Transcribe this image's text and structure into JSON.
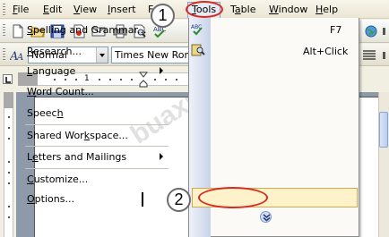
{
  "menubar": {
    "items": [
      {
        "label": "File",
        "mnemonic": "F",
        "rest": "ile"
      },
      {
        "label": "Edit",
        "mnemonic": "E",
        "rest": "dit"
      },
      {
        "label": "View",
        "mnemonic": "V",
        "rest": "iew"
      },
      {
        "label": "Insert",
        "mnemonic": "I",
        "rest": "nsert"
      },
      {
        "label": "F",
        "mnemonic": "F",
        "rest": ""
      },
      {
        "label": "Tools",
        "mnemonic": "T",
        "rest": "ools"
      },
      {
        "label": "Table",
        "mnemonic": "a",
        "pre": "T",
        "rest": "ble"
      },
      {
        "label": "Window",
        "mnemonic": "W",
        "rest": "indow"
      },
      {
        "label": "Help",
        "mnemonic": "H",
        "rest": "elp"
      }
    ]
  },
  "formatting": {
    "style": "Normal",
    "font": "Times New Roma"
  },
  "tools_menu": {
    "items": [
      {
        "pre": "",
        "mn": "S",
        "post": "pelling and Grammar...",
        "shortcut": "F7",
        "icon": "spelling-icon"
      },
      {
        "pre": "",
        "mn": "R",
        "post": "esearch...",
        "shortcut": "Alt+Click",
        "icon": "research-icon"
      },
      {
        "pre": "",
        "mn": "L",
        "post": "anguage",
        "submenu": true
      },
      {
        "pre": "",
        "mn": "W",
        "post": "ord Count..."
      },
      {
        "pre": "Speec",
        "mn": "h",
        "post": ""
      },
      {
        "pre": "Shared Wor",
        "mn": "k",
        "post": "space..."
      },
      {
        "pre": "L",
        "mn": "e",
        "post": "tters and Mailings",
        "submenu": true
      },
      {
        "pre": "",
        "mn": "C",
        "post": "ustomize..."
      },
      {
        "pre": "",
        "mn": "O",
        "post": "ptions..."
      }
    ]
  },
  "annotations": {
    "step1": "1",
    "step2": "2"
  },
  "watermark": "buaxua.vn",
  "colors": {
    "highlight_ring": "#d62b22",
    "menu_hover": "#fdf2c9",
    "menu_strip": "#c9d4ea"
  }
}
